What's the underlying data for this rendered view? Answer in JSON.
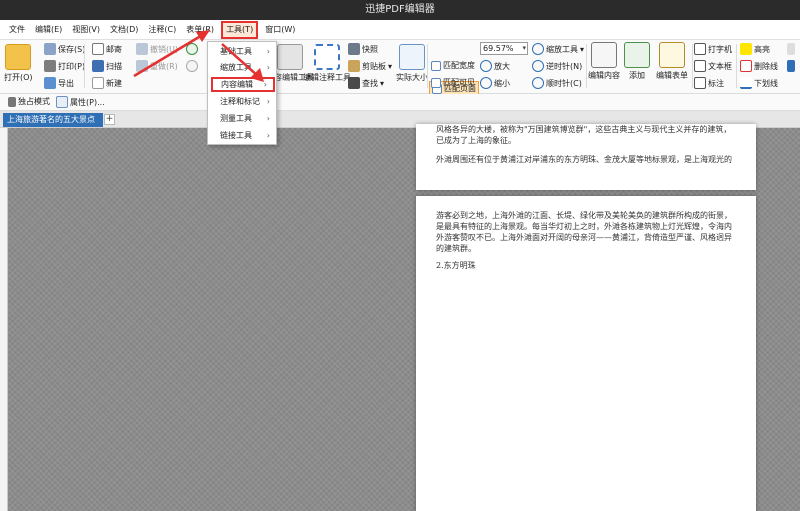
{
  "title": "迅捷PDF编辑器",
  "menu": [
    "文件",
    "编辑(E)",
    "视图(V)",
    "文档(D)",
    "注释(C)",
    "表单(R)",
    "工具(T)",
    "窗口(W)"
  ],
  "ribbon": {
    "open": "打开(O)",
    "save": "保存(S)",
    "print": "打印(P)",
    "export": "导出",
    "mail": "邮寄",
    "scan": "扫描",
    "new": "新建",
    "undo": "撤销(U)",
    "redo": "重做(R)",
    "content_edit_tool": "内容编辑工具",
    "annotation_edit_tool": "编辑注释工具",
    "snapshot": "快照",
    "clipboard": "剪贴板",
    "find": "查找",
    "actual_size": "实际大小",
    "fit_page": "匹配页面",
    "fit_width": "匹配宽度",
    "fit_visible": "匹配可见",
    "zoom_value": "69.57%",
    "zoom_tool": "缩放工具",
    "zoom_in": "放大",
    "zoom_out": "缩小",
    "rotate_ccw": "逆时针(N)",
    "rotate_cw": "顺时针(C)",
    "edit_content": "编辑内容",
    "add": "添加",
    "edit_form": "编辑表单",
    "typewriter": "打字机",
    "textbox": "文本框",
    "callout": "标注",
    "highlight": "高亮",
    "strikeout": "删除线",
    "underline": "下划线"
  },
  "toolbar2": {
    "sticky_mode": "独占模式",
    "properties": "属性(P)..."
  },
  "tab": {
    "label": "上海旅游著名的五大景点",
    "close": "×",
    "new": "+"
  },
  "dropdown": [
    {
      "label": "基础工具"
    },
    {
      "label": "缩放工具"
    },
    {
      "label": "内容编辑"
    },
    {
      "label": "注释和标记"
    },
    {
      "label": "测量工具"
    },
    {
      "label": "链接工具"
    }
  ],
  "page1": {
    "para1": "风格各异的大楼，被称为\"万国建筑博览群\"，这些古典主义与现代主义并存的建筑，已成为了上海的象征。",
    "para2": "外滩周围还有位于黄浦江对岸浦东的东方明珠、金茂大厦等地标景观，是上海观光的"
  },
  "page2": {
    "para1": "游客必到之地，上海外滩的江面、长堤、绿化带及美轮美奂的建筑群所构成的街景，是最具有特征的上海景观。每当华灯初上之时，外滩各栋建筑物上灯光辉煌，令海内外游客赞叹不已。上海外滩面对开阔的母亲河——黄浦江，背倚造型严谨、风格迥异的建筑群。",
    "heading": "2.东方明珠"
  },
  "colors": {
    "highlight_red": "#e5312f",
    "tab_blue": "#2f6fb5",
    "fit_page_bg": "#fde3b8"
  }
}
